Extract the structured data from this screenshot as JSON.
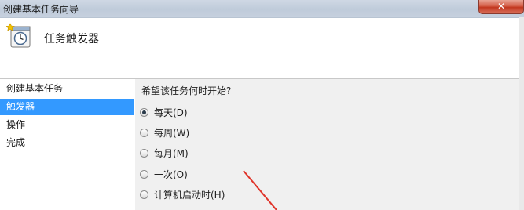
{
  "window": {
    "title": "创建基本任务向导",
    "close_icon": "close-icon"
  },
  "header": {
    "heading": "任务触发器",
    "icon": "calendar-clock-icon"
  },
  "sidebar": {
    "items": [
      {
        "label": "创建基本任务",
        "selected": false
      },
      {
        "label": "触发器",
        "selected": true
      },
      {
        "label": "操作",
        "selected": false
      },
      {
        "label": "完成",
        "selected": false
      }
    ]
  },
  "main": {
    "question": "希望该任务何时开始?",
    "options": [
      {
        "label": "每天(D)",
        "checked": true
      },
      {
        "label": "每周(W)",
        "checked": false
      },
      {
        "label": "每月(M)",
        "checked": false
      },
      {
        "label": "一次(O)",
        "checked": false
      },
      {
        "label": "计算机启动时(H)",
        "checked": false
      }
    ]
  },
  "colors": {
    "selection": "#3399ff",
    "annotation_arrow": "#e0342a"
  }
}
